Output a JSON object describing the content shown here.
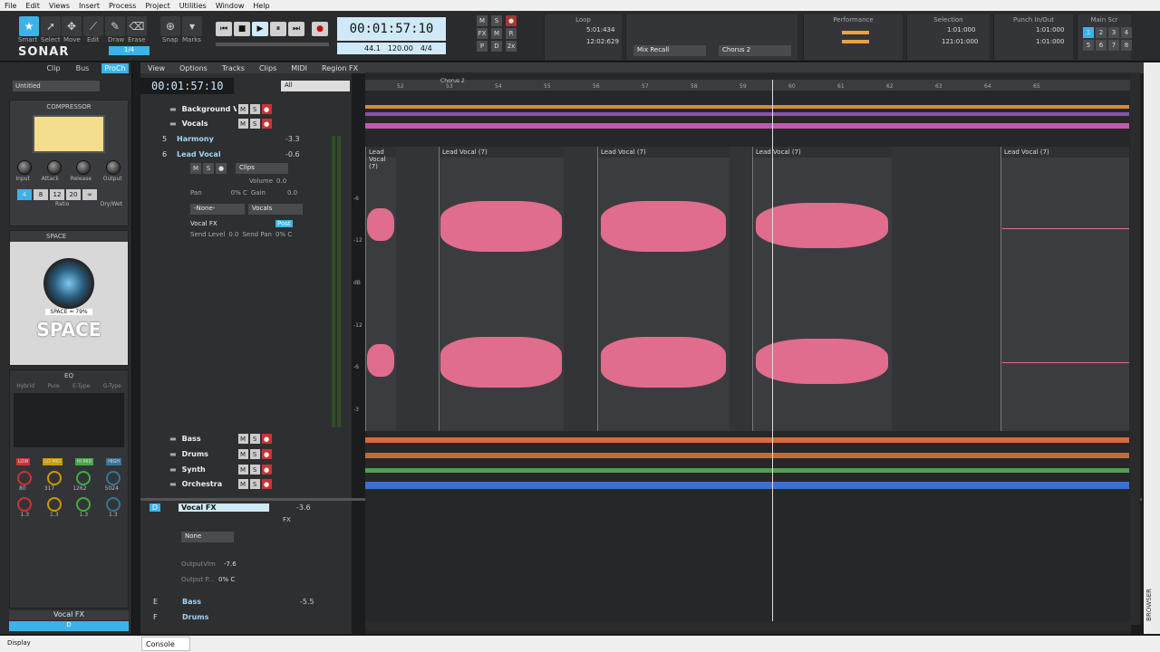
{
  "menu": [
    "File",
    "Edit",
    "Views",
    "Insert",
    "Process",
    "Project",
    "Utilities",
    "Window",
    "Help"
  ],
  "tools": [
    {
      "name": "Smart",
      "icon": "star"
    },
    {
      "name": "Select",
      "icon": "arrow"
    },
    {
      "name": "Move",
      "icon": "move"
    },
    {
      "name": "Edit",
      "icon": "edit"
    },
    {
      "name": "Draw",
      "icon": "pencil"
    },
    {
      "name": "Erase",
      "icon": "eraser"
    }
  ],
  "snap_label": "Snap",
  "marks_label": "Marks",
  "snap_value": "1/4",
  "app_logo": "SONAR",
  "transport": {
    "time": "00:01:57:10",
    "tempo": "120.00",
    "meter": "4/4",
    "sample_rate": "44.1",
    "bits": "16"
  },
  "loop": {
    "title": "Loop",
    "start": "5:01:434",
    "end": "12:02:629"
  },
  "mix_recall": "Mix Recall",
  "arrangement": "Chorus 2",
  "performance_title": "Performance",
  "selection": {
    "title": "Selection",
    "start": "1:01:000",
    "end": "121:01:000"
  },
  "punch": {
    "title": "Punch In/Out",
    "start": "1:01:000",
    "end": "1:01:000"
  },
  "screens": {
    "title": "Main Scr",
    "numbers": [
      "1",
      "2",
      "3",
      "4",
      "5",
      "6",
      "7",
      "8"
    ]
  },
  "inspector": {
    "tabs": [
      "Clip",
      "Bus",
      "ProCh"
    ],
    "preset": "Untitled",
    "compressor_title": "COMPRESSOR",
    "compressor_knobs": [
      "Input",
      "Attack",
      "Release",
      "Output"
    ],
    "ratios": [
      "4",
      "8",
      "12",
      "20",
      "∞"
    ],
    "ratio_label": "Ratio",
    "drywet_label": "Dry/Wet",
    "space_title": "SPACE",
    "space_readout": "SPACE = 79%",
    "space_logo": "SPACE",
    "eq_title": "EQ",
    "eq_modes": [
      "Hybrid",
      "Pure",
      "E-Type",
      "G-Type"
    ],
    "eq_bands": [
      "LOW",
      "LO MID",
      "HI MID",
      "HIGH"
    ],
    "eq_freqs": [
      "80",
      "317",
      "1262",
      "5024"
    ],
    "eq_gains": [
      "1.3",
      "1.3",
      "1.3",
      "1.3"
    ],
    "strip_name": "Vocal FX",
    "strip_footer": "D"
  },
  "time_display": "00:01:57:10",
  "filter": "All",
  "viewbar": [
    "View",
    "Options",
    "Tracks",
    "Clips",
    "MIDI",
    "Region FX"
  ],
  "tracks": [
    {
      "num": "",
      "name": "Background Voc",
      "folder": true
    },
    {
      "num": "",
      "name": "Vocals",
      "folder": true
    },
    {
      "num": "5",
      "name": "Harmony",
      "value": "-3.3"
    },
    {
      "num": "6",
      "name": "Lead Vocal",
      "value": "-0.6"
    }
  ],
  "lead_vocal_detail": {
    "clips_label": "Clips",
    "volume_label": "Volume",
    "volume_value": "0.0",
    "pan_label": "Pan",
    "pan_value": "0% C",
    "gain_label": "Gain",
    "gain_value": "0.0",
    "input": "-None-",
    "output": "Vocals",
    "send": "Vocal FX",
    "post": "Post",
    "send_level_label": "Send Level",
    "send_level_value": "0.0",
    "send_pan_label": "Send Pan",
    "send_pan_value": "0% C"
  },
  "folders_bottom": [
    "Bass",
    "Drums",
    "Synth",
    "Orchestra"
  ],
  "bus_pane": {
    "bus_letter": "D",
    "bus_name": "Vocal FX",
    "bus_value": "-3.6",
    "fx_label": "FX",
    "output": "None",
    "output_vol_label": "OutputVlm",
    "output_vol_value": "-7.6",
    "output_pan_label": "Output P...",
    "output_pan_value": "0% C",
    "buses": [
      {
        "letter": "E",
        "name": "Bass",
        "value": "-5.5"
      },
      {
        "letter": "F",
        "name": "Drums",
        "value": ""
      }
    ]
  },
  "ruler_marks": [
    "52",
    "53",
    "54",
    "55",
    "56",
    "57",
    "58",
    "59",
    "60",
    "61",
    "62",
    "63",
    "64",
    "65"
  ],
  "ruler_marker": "Chorus 2",
  "clips": [
    {
      "label": "Lead Vocal (7)"
    },
    {
      "label": "Lead Vocal (7)"
    },
    {
      "label": "Lead Vocal (7)"
    },
    {
      "label": "Lead Vocal (7)"
    },
    {
      "label": "Lead Vocal (7)"
    }
  ],
  "db_scale": [
    "-6",
    "-12",
    "dB",
    "-12",
    "-6",
    "-3"
  ],
  "status": {
    "display": "Display",
    "console": "Console",
    "browser": "BROWSER"
  }
}
